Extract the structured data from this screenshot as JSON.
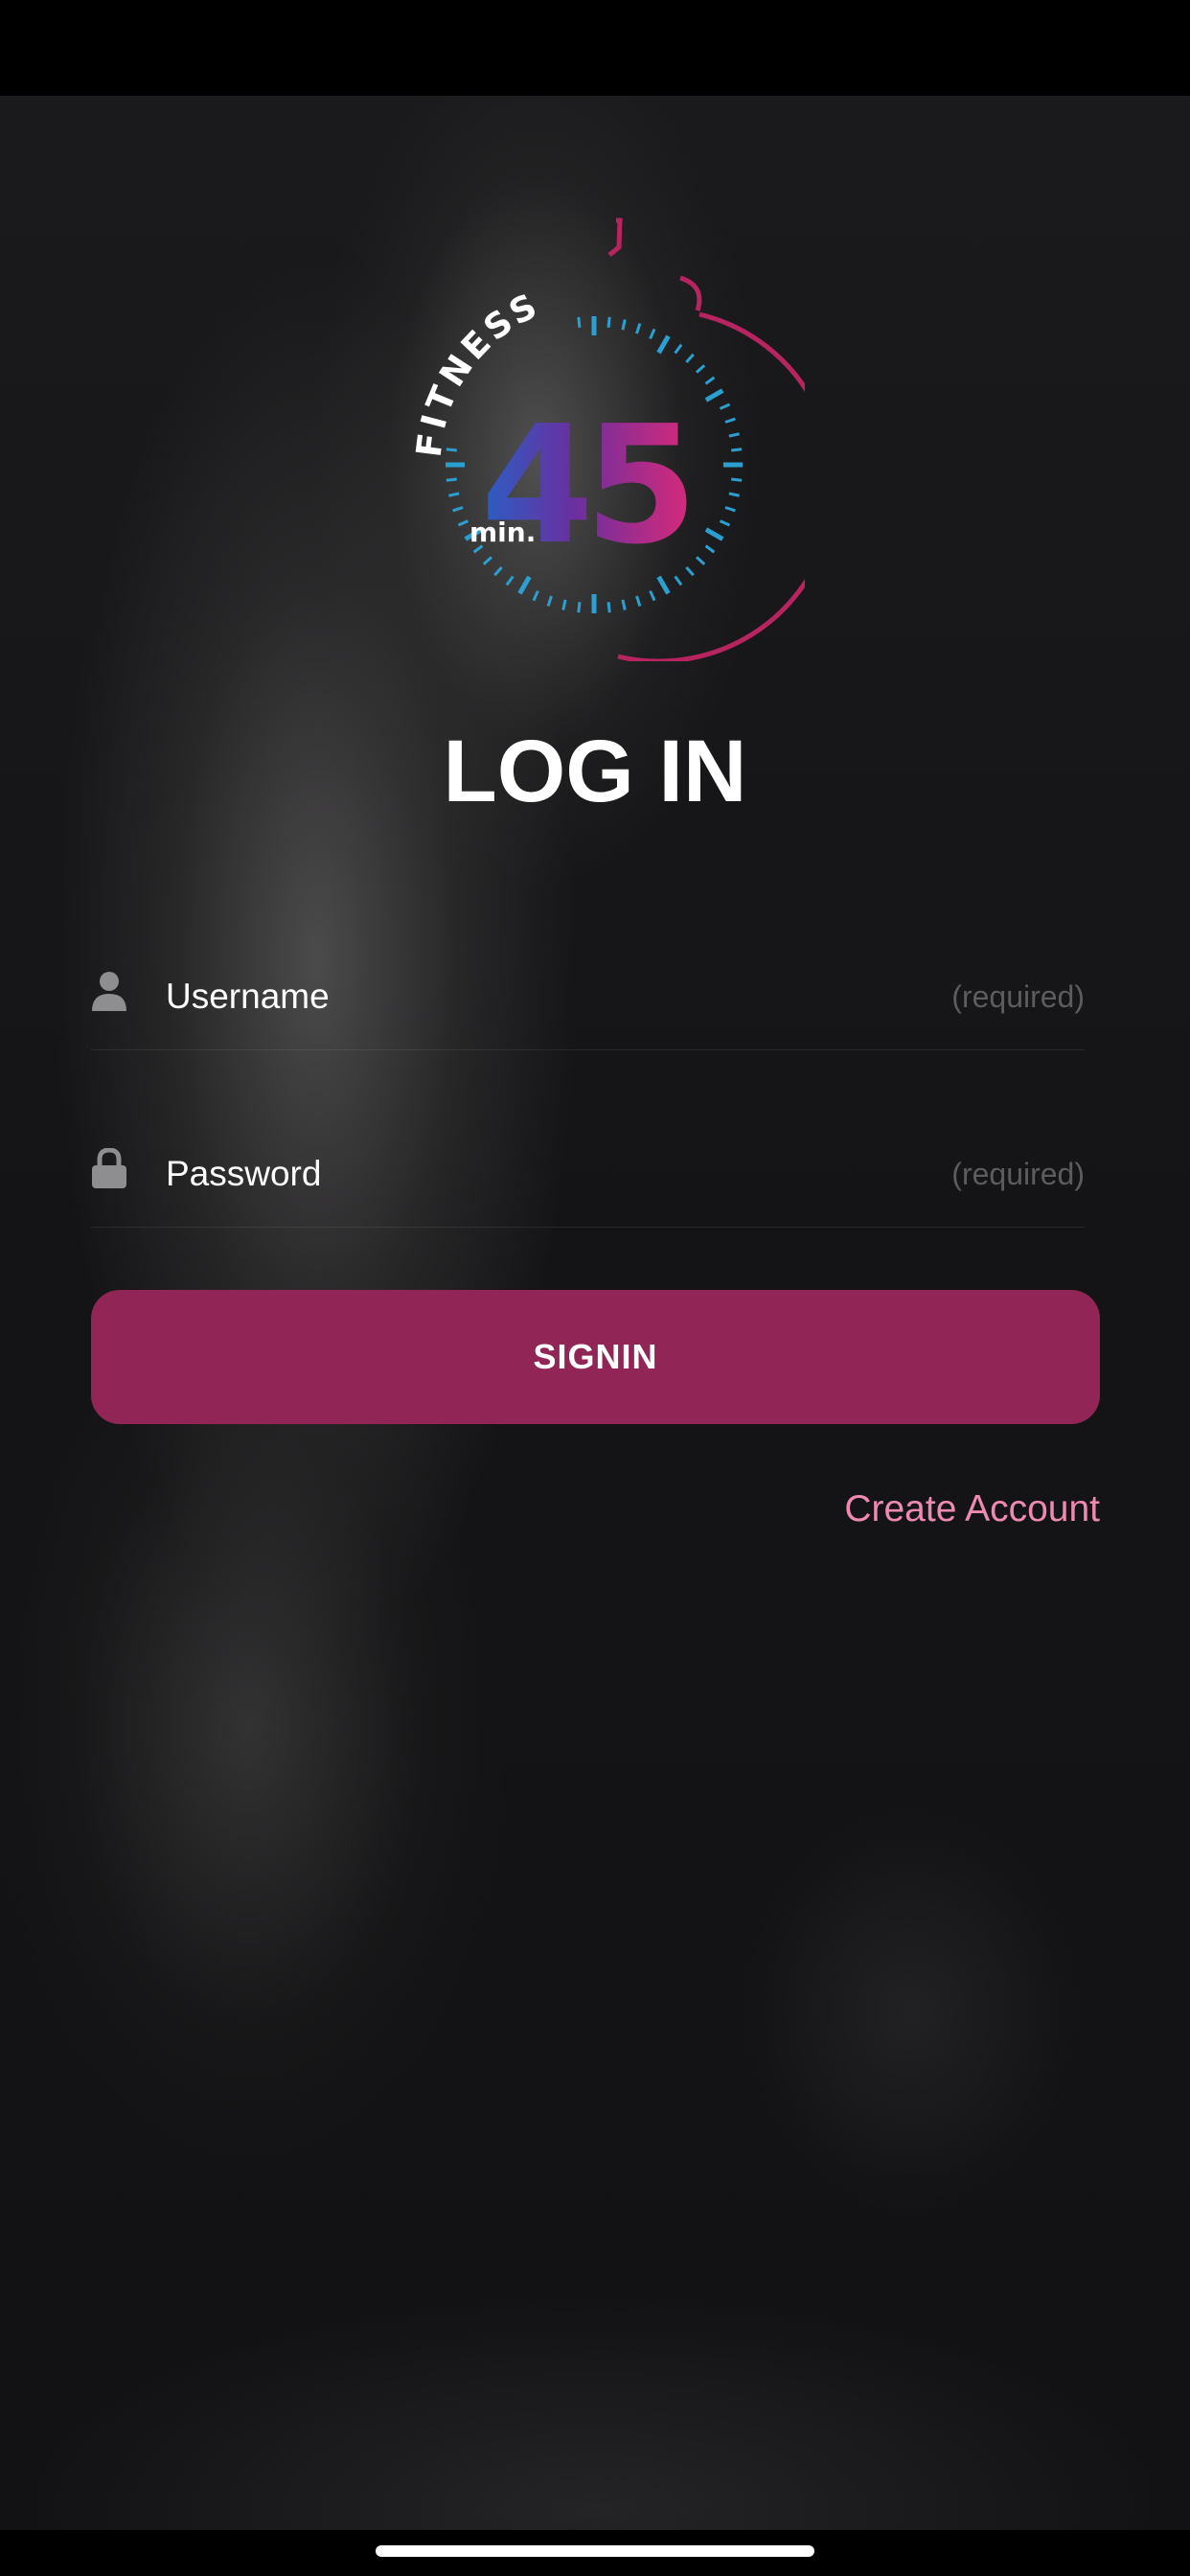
{
  "app": {
    "logo_word": "FITNESS",
    "logo_number": "45",
    "logo_unit": "min."
  },
  "login": {
    "title": "LOG IN",
    "username": {
      "placeholder": "Username",
      "value": "",
      "hint": "(required)",
      "icon": "user-icon"
    },
    "password": {
      "placeholder": "Password",
      "value": "",
      "hint": "(required)",
      "icon": "lock-icon"
    },
    "signin_label": "SIGNIN",
    "create_account_label": "Create Account"
  },
  "colors": {
    "accent": "#912555",
    "link": "#ee8ab1",
    "logo_blue": "#2a9fd0",
    "logo_purple": "#6a2fa0",
    "logo_magenta": "#c4246e",
    "background": "#141416"
  }
}
